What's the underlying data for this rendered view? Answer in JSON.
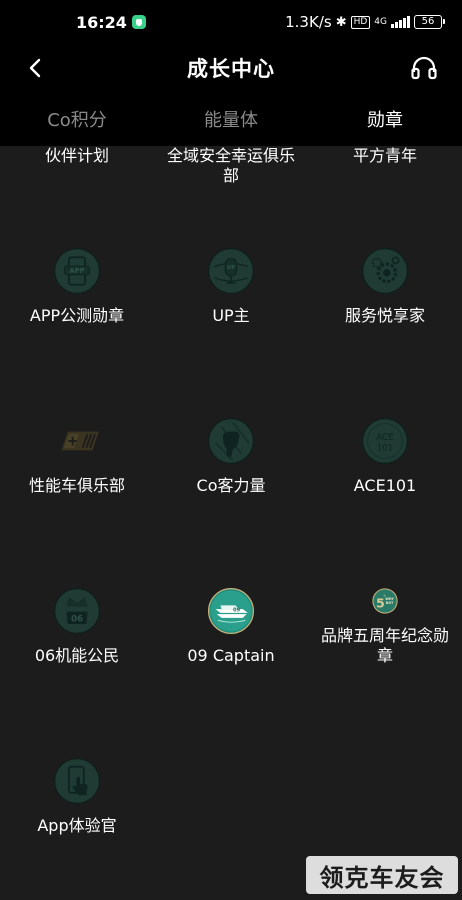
{
  "status_bar": {
    "time": "16:24",
    "net_speed": "1.3K/s",
    "hd_label": "HD",
    "network": "4G",
    "battery": "56"
  },
  "nav": {
    "title": "成长中心",
    "back_icon": "chevron-left-icon",
    "service_icon": "headset-icon"
  },
  "tabs": [
    {
      "label": "Co积分",
      "active": false
    },
    {
      "label": "能量体",
      "active": false
    },
    {
      "label": "勋章",
      "active": true
    }
  ],
  "partial_row": [
    "伙伴计划",
    "全域安全幸运俱乐部",
    "平方青年"
  ],
  "badges": [
    {
      "label": "APP公测勋章",
      "icon": "app-phone-badge-icon",
      "earned": false
    },
    {
      "label": "UP主",
      "icon": "up-microphone-badge-icon",
      "earned": false
    },
    {
      "label": "服务悦享家",
      "icon": "gear-service-badge-icon",
      "earned": false
    },
    {
      "label": "性能车俱乐部",
      "icon": "stripe-flag-badge-icon",
      "earned": false
    },
    {
      "label": "Co客力量",
      "icon": "fist-badge-icon",
      "earned": false
    },
    {
      "label": "ACE101",
      "icon": "ace101-badge-icon",
      "badge_text": "ACE\n101",
      "earned": false
    },
    {
      "label": "06机能公民",
      "icon": "06-citizen-badge-icon",
      "badge_text": "06",
      "earned": false
    },
    {
      "label": "09 Captain",
      "icon": "yacht-09-badge-icon",
      "badge_text": "09",
      "earned": true
    },
    {
      "label": "品牌五周年纪念勋章",
      "icon": "5th-why-not-badge-icon",
      "badge_text": "5th WHY NOT",
      "earned": true
    },
    {
      "label": "App体验官",
      "icon": "phone-hand-badge-icon",
      "earned": false
    }
  ],
  "watermark": "领克车友会",
  "colors": {
    "background": "#1c1c1c",
    "header": "#000000",
    "badge_locked": "#1f3b34",
    "badge_earned": "#2a9a86",
    "gold": "#c8b27a"
  }
}
